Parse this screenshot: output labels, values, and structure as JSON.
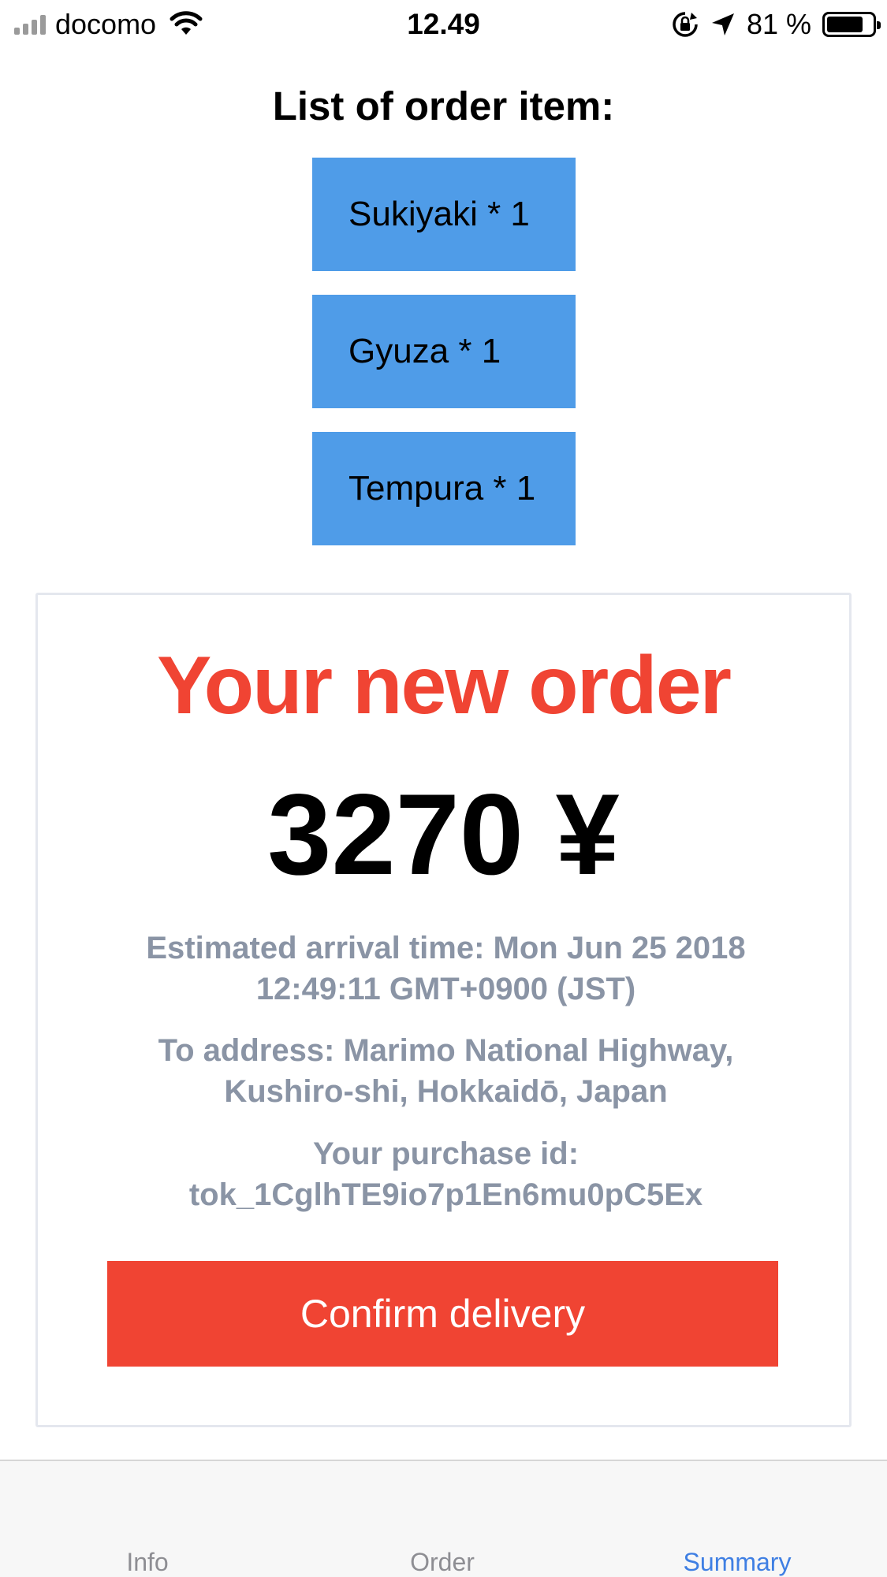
{
  "status_bar": {
    "carrier": "docomo",
    "time": "12.49",
    "battery_percent": "81 %",
    "battery_level": 0.81
  },
  "order_list": {
    "title": "List of order item:",
    "items": [
      "Sukiyaki * 1",
      "Gyuza * 1",
      "Tempura * 1"
    ]
  },
  "summary": {
    "title": "Your new order",
    "total": "3270 ¥",
    "arrival_line1": "Estimated arrival time: Mon Jun 25 2018",
    "arrival_line2": "12:49:11 GMT+0900 (JST)",
    "address_line1": "To address: Marimo National Highway,",
    "address_line2": "Kushiro-shi, Hokkaidō, Japan",
    "purchase_line1": "Your purchase id:",
    "purchase_line2": "tok_1CglhTE9io7p1En6mu0pC5Ex",
    "confirm_label": "Confirm delivery"
  },
  "tabs": [
    {
      "label": "Info",
      "active": false
    },
    {
      "label": "Order",
      "active": false
    },
    {
      "label": "Summary",
      "active": true
    }
  ],
  "colors": {
    "item_blue": "#4f9ce8",
    "accent_red": "#f04433",
    "active_tab": "#3f7fe3",
    "muted_text": "#8a94a5"
  },
  "icons": [
    "cellular-signal-icon",
    "wifi-icon",
    "orientation-lock-icon",
    "location-arrow-icon",
    "battery-icon"
  ]
}
